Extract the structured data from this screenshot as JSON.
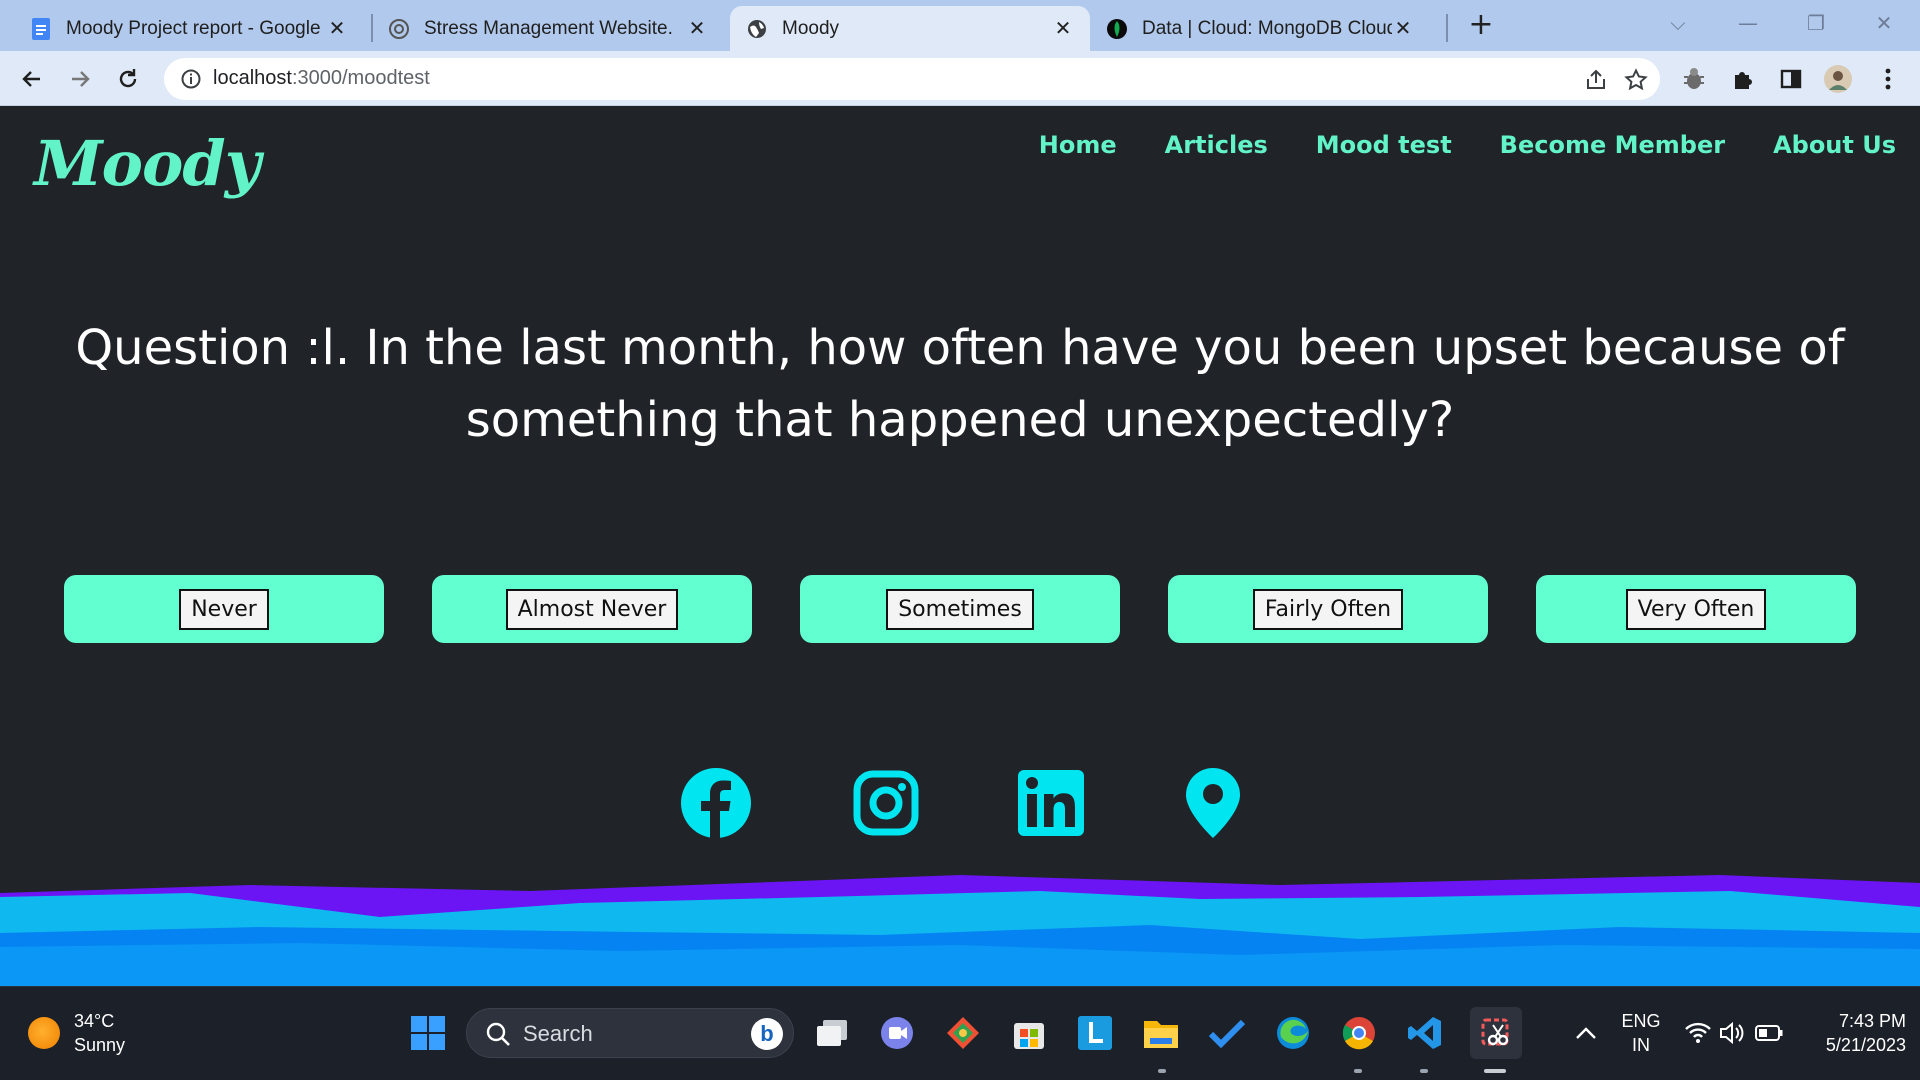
{
  "browser": {
    "tabs": [
      {
        "title": "Moody Project report - Google D",
        "favicon": "google-docs-icon",
        "active": false
      },
      {
        "title": "Stress Management Website.",
        "favicon": "chatgpt-icon",
        "active": false
      },
      {
        "title": "Moody",
        "favicon": "globe-icon",
        "active": true
      },
      {
        "title": "Data | Cloud: MongoDB Cloud",
        "favicon": "mongodb-leaf-icon",
        "active": false
      }
    ],
    "url_host": "localhost",
    "url_path": ":3000/moodtest"
  },
  "site": {
    "logo": "Moody",
    "nav": [
      {
        "label": "Home"
      },
      {
        "label": "Articles"
      },
      {
        "label": "Mood test"
      },
      {
        "label": "Become Member"
      },
      {
        "label": "About Us"
      }
    ],
    "question": "Question :l. In the last month, how often have you been upset because of something that happened unexpectedly?",
    "answers": [
      {
        "label": "Never"
      },
      {
        "label": "Almost Never"
      },
      {
        "label": "Sometimes"
      },
      {
        "label": "Fairly Often"
      },
      {
        "label": "Very Often"
      }
    ],
    "socials": [
      "facebook-icon",
      "instagram-icon",
      "linkedin-icon",
      "location-pin-icon"
    ],
    "colors": {
      "accent": "#62f4c8",
      "answer_card": "#62ffd0",
      "social_icons": "#00e5f0",
      "background": "#202328"
    }
  },
  "taskbar": {
    "weather_temp": "34°C",
    "weather_desc": "Sunny",
    "search_label": "Search",
    "lang_1": "ENG",
    "lang_2": "IN",
    "time": "7:43 PM",
    "date": "5/21/2023"
  }
}
